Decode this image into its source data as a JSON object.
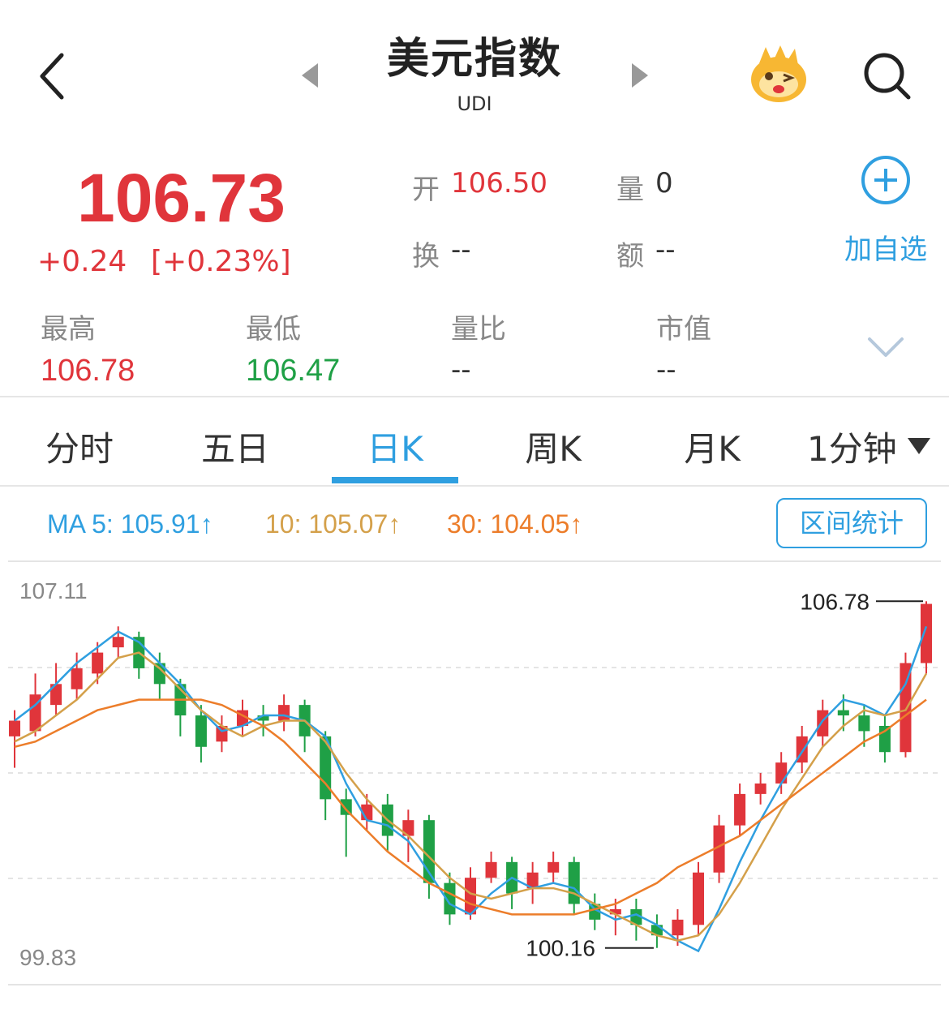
{
  "header": {
    "title": "美元指数",
    "code": "UDI"
  },
  "quote": {
    "price": "106.73",
    "change": "+0.24",
    "change_pct": "[+0.23%]",
    "open_label": "开",
    "open": "106.50",
    "volume_label": "量",
    "volume": "0",
    "turnover_label": "换",
    "turnover": "--",
    "amount_label": "额",
    "amount": "--",
    "add_label": "加自选"
  },
  "stats": [
    {
      "label": "最高",
      "value": "106.78"
    },
    {
      "label": "最低",
      "value": "106.47"
    },
    {
      "label": "量比",
      "value": "--"
    },
    {
      "label": "市值",
      "value": "--"
    }
  ],
  "tabs": [
    "分时",
    "五日",
    "日K",
    "周K",
    "月K",
    "1分钟"
  ],
  "active_tab": "日K",
  "ma": {
    "ma5": "MA 5: 105.91↑",
    "ma10": "10: 105.07↑",
    "ma30": "30: 104.05↑"
  },
  "range_button": "区间统计",
  "colors": {
    "up": "#e0353b",
    "down": "#1fa046",
    "accent": "#2f9fe0",
    "ma5": "#2f9fe0",
    "ma10": "#d4a04a",
    "ma30": "#ec7d2a"
  },
  "chart_data": {
    "type": "candlestick",
    "ylim": [
      99.83,
      107.11
    ],
    "y_tick_labels": [
      "107.11",
      "99.83"
    ],
    "max_label": "106.78",
    "min_label": "100.16",
    "grid": true,
    "ma_lines": [
      {
        "name": "MA 5",
        "values": [
          104.5,
          104.8,
          105.2,
          105.6,
          105.9,
          106.2,
          106.0,
          105.6,
          105.2,
          104.7,
          104.3,
          104.4,
          104.6,
          104.6,
          104.5,
          104.2,
          103.3,
          102.6,
          102.5,
          102.2,
          101.6,
          101.0,
          100.8,
          101.2,
          101.5,
          101.3,
          101.4,
          101.3,
          100.9,
          100.7,
          100.8,
          100.6,
          100.3,
          100.1,
          100.9,
          101.8,
          102.6,
          103.3,
          103.9,
          104.5,
          104.9,
          104.8,
          104.6,
          105.2,
          106.3
        ]
      },
      {
        "name": "10",
        "values": [
          104.1,
          104.3,
          104.6,
          104.9,
          105.3,
          105.7,
          105.8,
          105.5,
          105.1,
          104.7,
          104.4,
          104.2,
          104.4,
          104.5,
          104.5,
          104.1,
          103.5,
          103.0,
          102.6,
          102.3,
          101.9,
          101.5,
          101.2,
          101.1,
          101.2,
          101.3,
          101.3,
          101.2,
          101.0,
          100.8,
          100.6,
          100.4,
          100.3,
          100.4,
          100.8,
          101.4,
          102.1,
          102.8,
          103.4,
          104.0,
          104.4,
          104.7,
          104.6,
          104.7,
          105.4
        ]
      },
      {
        "name": "30",
        "values": [
          104.0,
          104.1,
          104.3,
          104.5,
          104.7,
          104.8,
          104.9,
          104.9,
          104.9,
          104.9,
          104.8,
          104.6,
          104.4,
          104.1,
          103.7,
          103.3,
          102.8,
          102.4,
          102.0,
          101.7,
          101.4,
          101.2,
          101.0,
          100.9,
          100.8,
          100.8,
          100.8,
          100.8,
          100.9,
          101.0,
          101.2,
          101.4,
          101.7,
          101.9,
          102.1,
          102.3,
          102.6,
          102.9,
          103.2,
          103.5,
          103.8,
          104.1,
          104.3,
          104.6,
          104.9
        ]
      }
    ],
    "candles": [
      [
        104.2,
        104.5,
        103.6,
        104.7
      ],
      [
        104.3,
        105.0,
        104.2,
        105.4
      ],
      [
        104.8,
        105.2,
        104.6,
        105.6
      ],
      [
        105.1,
        105.5,
        104.9,
        105.8
      ],
      [
        105.4,
        105.8,
        105.2,
        106.0
      ],
      [
        105.9,
        106.1,
        105.7,
        106.3
      ],
      [
        106.1,
        105.5,
        105.3,
        106.2
      ],
      [
        105.6,
        105.2,
        104.9,
        105.8
      ],
      [
        105.2,
        104.6,
        104.2,
        105.3
      ],
      [
        104.6,
        104.0,
        103.7,
        104.8
      ],
      [
        104.1,
        104.4,
        103.9,
        104.6
      ],
      [
        104.4,
        104.7,
        104.2,
        104.9
      ],
      [
        104.6,
        104.5,
        104.2,
        104.8
      ],
      [
        104.5,
        104.8,
        104.3,
        105.0
      ],
      [
        104.8,
        104.2,
        103.9,
        104.9
      ],
      [
        104.2,
        103.0,
        102.6,
        104.3
      ],
      [
        103.0,
        102.7,
        101.9,
        103.2
      ],
      [
        102.6,
        102.9,
        102.4,
        103.1
      ],
      [
        102.9,
        102.3,
        102.0,
        103.1
      ],
      [
        102.3,
        102.6,
        101.8,
        102.8
      ],
      [
        102.6,
        101.4,
        101.1,
        102.7
      ],
      [
        101.4,
        100.8,
        100.6,
        101.6
      ],
      [
        100.8,
        101.5,
        100.7,
        101.7
      ],
      [
        101.5,
        101.8,
        101.4,
        102.0
      ],
      [
        101.8,
        101.2,
        100.9,
        101.9
      ],
      [
        101.3,
        101.6,
        101.0,
        101.8
      ],
      [
        101.6,
        101.8,
        101.4,
        102.0
      ],
      [
        101.8,
        101.0,
        100.8,
        101.9
      ],
      [
        101.0,
        100.7,
        100.5,
        101.2
      ],
      [
        100.8,
        100.9,
        100.4,
        101.1
      ],
      [
        100.9,
        100.6,
        100.3,
        101.1
      ],
      [
        100.6,
        100.4,
        100.16,
        100.8
      ],
      [
        100.4,
        100.7,
        100.2,
        100.9
      ],
      [
        100.6,
        101.6,
        100.4,
        101.8
      ],
      [
        101.6,
        102.5,
        101.4,
        102.7
      ],
      [
        102.5,
        103.1,
        102.3,
        103.3
      ],
      [
        103.1,
        103.3,
        102.9,
        103.5
      ],
      [
        103.3,
        103.7,
        103.1,
        103.9
      ],
      [
        103.7,
        104.2,
        103.5,
        104.4
      ],
      [
        104.2,
        104.7,
        104.0,
        104.9
      ],
      [
        104.7,
        104.6,
        104.3,
        105.0
      ],
      [
        104.6,
        104.3,
        104.0,
        104.8
      ],
      [
        104.4,
        103.9,
        103.7,
        104.6
      ],
      [
        103.9,
        105.6,
        103.8,
        105.8
      ],
      [
        105.6,
        106.73,
        105.4,
        106.78
      ]
    ]
  }
}
